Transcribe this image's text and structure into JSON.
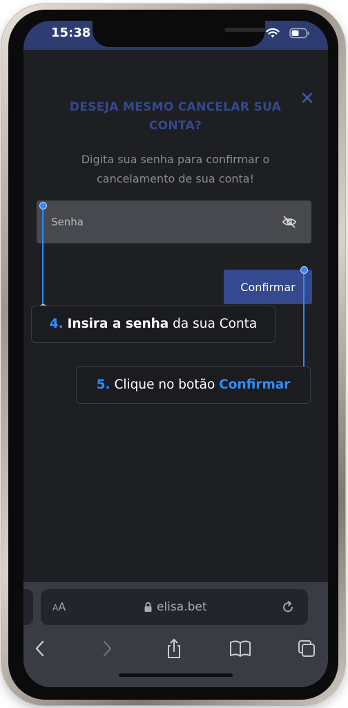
{
  "status_bar": {
    "time": "15:38"
  },
  "modal": {
    "title": "DESEJA MESMO CANCELAR SUA CONTA?",
    "subtitle": "Digita sua senha para confirmar o cancelamento de sua conta!",
    "password_placeholder": "Senha",
    "confirm_label": "Confirmar",
    "close_symbol": "✕"
  },
  "callouts": [
    {
      "number": "4.",
      "bold_text": "Insira a senha",
      "text": " da sua Conta"
    },
    {
      "number": "5.",
      "text": " Clique no botão ",
      "bold_text": "Confirmar"
    }
  ],
  "browser": {
    "aa_label_small": "A",
    "aa_label_large": "A",
    "url": "elisa.bet"
  },
  "colors": {
    "accent_blue": "#2f8bff",
    "primary_button": "#34498f",
    "title_color": "#34498f",
    "status_bar": "#2d3d72"
  },
  "icons": {
    "status": [
      "wifi-icon",
      "battery-icon"
    ],
    "field": "eye-slash-icon",
    "browser": [
      "lock-icon",
      "reload-icon",
      "back-icon",
      "forward-icon",
      "share-icon",
      "bookmarks-icon",
      "tabs-icon"
    ]
  }
}
